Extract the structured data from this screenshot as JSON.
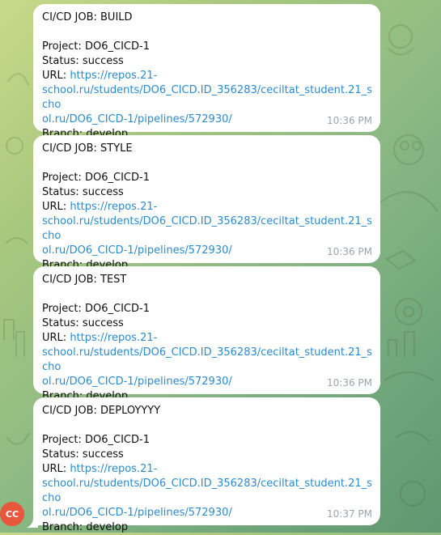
{
  "messages": [
    {
      "job_line": "CI/CD JOB: BUILD",
      "project_line": "Project: DO6_CICD-1",
      "status_line": "Status: success",
      "url_label": "URL: ",
      "url_part1": "https://repos.21-",
      "url_part2": "school.ru/students/DO6_CICD.ID_356283/ceciltat_student.21_scho",
      "url_part3": "ol.ru/DO6_CICD-1/pipelines/572930/",
      "branch_line": "Branch: develop",
      "time": "10:36 PM"
    },
    {
      "job_line": "CI/CD JOB: STYLE",
      "project_line": "Project: DO6_CICD-1",
      "status_line": "Status: success",
      "url_label": "URL: ",
      "url_part1": "https://repos.21-",
      "url_part2": "school.ru/students/DO6_CICD.ID_356283/ceciltat_student.21_scho",
      "url_part3": "ol.ru/DO6_CICD-1/pipelines/572930/",
      "branch_line": "Branch: develop",
      "time": "10:36 PM"
    },
    {
      "job_line": "CI/CD JOB: TEST",
      "project_line": "Project: DO6_CICD-1",
      "status_line": "Status: success",
      "url_label": "URL: ",
      "url_part1": "https://repos.21-",
      "url_part2": "school.ru/students/DO6_CICD.ID_356283/ceciltat_student.21_scho",
      "url_part3": "ol.ru/DO6_CICD-1/pipelines/572930/",
      "branch_line": "Branch: develop",
      "time": "10:36 PM"
    },
    {
      "job_line": "CI/CD JOB: DEPLOYYYY",
      "project_line": "Project: DO6_CICD-1",
      "status_line": "Status: success",
      "url_label": "URL: ",
      "url_part1": "https://repos.21-",
      "url_part2": "school.ru/students/DO6_CICD.ID_356283/ceciltat_student.21_scho",
      "url_part3": "ol.ru/DO6_CICD-1/pipelines/572930/",
      "branch_line": "Branch: develop",
      "time": "10:37 PM"
    }
  ],
  "sender": {
    "avatar_initials": "CC",
    "avatar_color": "#e8563c"
  },
  "colors": {
    "link": "#2b8ad0",
    "time": "#9aa3ad",
    "bubble": "#ffffff"
  }
}
